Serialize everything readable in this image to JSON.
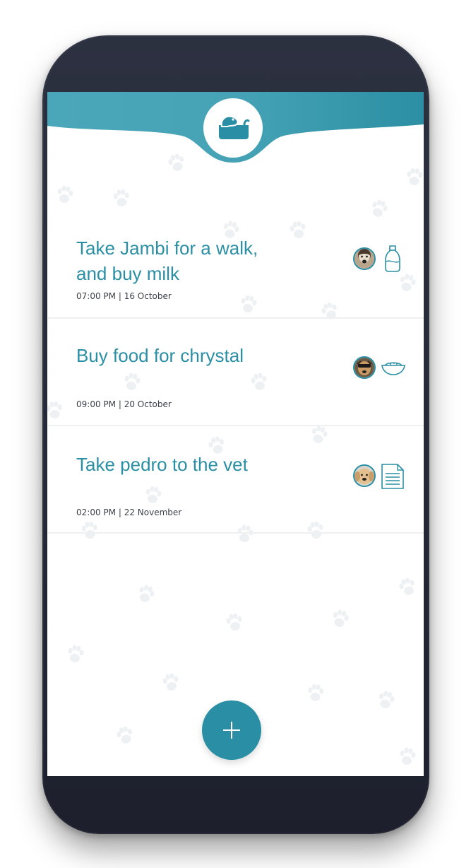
{
  "app": {
    "logo_icon": "dog-bowl-icon",
    "accent_color": "#2a8fa5",
    "header_color": "#3a9fb3"
  },
  "tasks": [
    {
      "title_line1": "Take Jambi for a walk,",
      "title_line2": "and buy milk",
      "time": "07:00 PM",
      "date": "16 October",
      "pet_avatar": "dog-avatar-jambi",
      "item_icon": "milk-bottle-icon"
    },
    {
      "title_line1": "Buy food for chrystal",
      "time": "09:00 PM",
      "date": "20 October",
      "pet_avatar": "dog-avatar-chrystal",
      "item_icon": "food-bowl-icon"
    },
    {
      "title_line1": "Take pedro to the vet",
      "time": "02:00 PM",
      "date": "22 November",
      "pet_avatar": "dog-avatar-pedro",
      "item_icon": "document-icon"
    }
  ],
  "meta_separator": "|",
  "fab": {
    "icon": "plus-icon"
  }
}
